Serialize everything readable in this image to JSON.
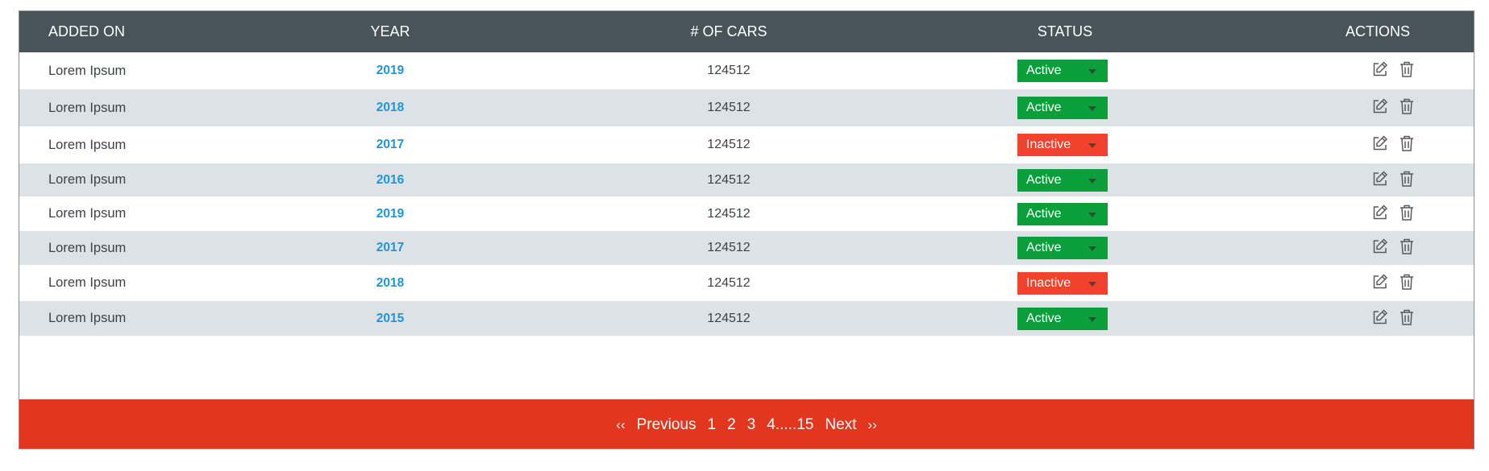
{
  "table": {
    "headers": [
      "ADDED ON",
      "YEAR",
      "# OF CARS",
      "STATUS",
      "ACTIONS"
    ],
    "rows": [
      {
        "added_on": "Lorem Ipsum",
        "year": "2019",
        "cars": "124512",
        "status": "Active"
      },
      {
        "added_on": "Lorem Ipsum",
        "year": "2018",
        "cars": "124512",
        "status": "Active"
      },
      {
        "added_on": "Lorem Ipsum",
        "year": "2017",
        "cars": "124512",
        "status": "Inactive"
      },
      {
        "added_on": "Lorem Ipsum",
        "year": "2016",
        "cars": "124512",
        "status": "Active"
      },
      {
        "added_on": "Lorem Ipsum",
        "year": "2019",
        "cars": "124512",
        "status": "Active"
      },
      {
        "added_on": "Lorem Ipsum",
        "year": "2017",
        "cars": "124512",
        "status": "Active"
      },
      {
        "added_on": "Lorem Ipsum",
        "year": "2018",
        "cars": "124512",
        "status": "Inactive"
      },
      {
        "added_on": "Lorem Ipsum",
        "year": "2015",
        "cars": "124512",
        "status": "Active"
      }
    ],
    "row_icons": [
      "edit-icon",
      "trash-icon"
    ]
  },
  "pagination": {
    "first": "‹‹",
    "previous": "Previous",
    "pages": [
      "1",
      "2",
      "3",
      "4.....15"
    ],
    "next": "Next",
    "last": "››"
  },
  "colors": {
    "header_bg": "#48535a",
    "alt_row_bg": "#dde2e6",
    "year_text": "#1b96dc",
    "active": "#0a9f3a",
    "inactive": "#f2412d",
    "pager_bg": "#e2361f"
  }
}
